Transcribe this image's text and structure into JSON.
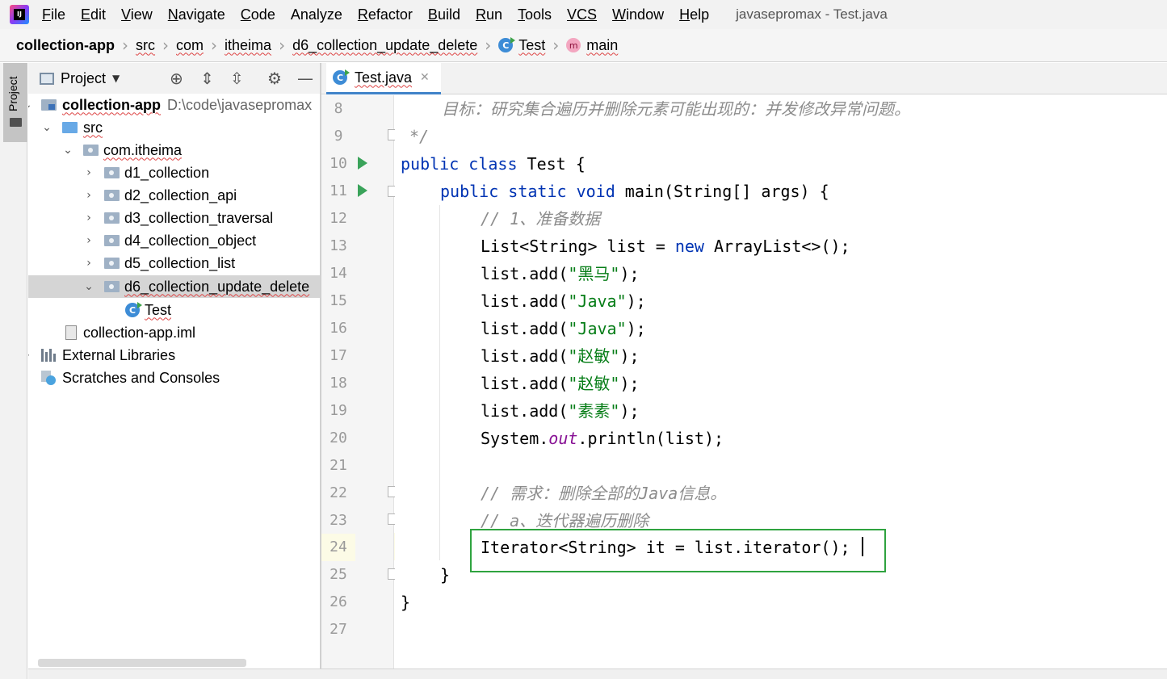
{
  "window": {
    "title": "javasepromax - Test.java"
  },
  "menu": [
    {
      "mn": "F",
      "rest": "ile"
    },
    {
      "mn": "E",
      "rest": "dit"
    },
    {
      "mn": "V",
      "rest": "iew"
    },
    {
      "mn": "N",
      "rest": "avigate"
    },
    {
      "mn": "C",
      "rest": "ode"
    },
    {
      "mn": "",
      "rest": "Analyze"
    },
    {
      "mn": "R",
      "rest": "efactor"
    },
    {
      "mn": "B",
      "rest": "uild"
    },
    {
      "mn": "R",
      "rest": "un"
    },
    {
      "mn": "T",
      "rest": "ools"
    },
    {
      "mn": "VCS",
      "rest": ""
    },
    {
      "mn": "W",
      "rest": "indow"
    },
    {
      "mn": "H",
      "rest": "elp"
    }
  ],
  "breadcrumb": [
    "collection-app",
    "src",
    "com",
    "itheima",
    "d6_collection_update_delete",
    "Test",
    "main"
  ],
  "project_panel": {
    "title": "Project",
    "tool_strip_label": "Project",
    "tree": {
      "module": "collection-app",
      "module_path": "D:\\code\\javasepromax",
      "src": "src",
      "package": "com.itheima",
      "folders": [
        "d1_collection",
        "d2_collection_api",
        "d3_collection_traversal",
        "d4_collection_object",
        "d5_collection_list",
        "d6_collection_update_delete"
      ],
      "class": "Test",
      "iml": "collection-app.iml",
      "ext_libs": "External Libraries",
      "scratches": "Scratches and Consoles"
    }
  },
  "editor": {
    "tab": "Test.java",
    "line_numbers": [
      "8",
      "9",
      "10",
      "11",
      "12",
      "13",
      "14",
      "15",
      "16",
      "17",
      "18",
      "19",
      "20",
      "21",
      "22",
      "23",
      "24",
      "25",
      "26",
      "27"
    ],
    "current_line": "24",
    "lines": {
      "l8": "目标：研究集合遍历并删除元素可能出现的：并发修改异常问题。",
      "l9": "*/",
      "l10_kw": "public class",
      "l10_rest": " Test {",
      "l11_kw1": "public static void",
      "l11_rest": " main(String[] args) {",
      "l12": "// 1、准备数据",
      "l13_a": "List<String> list = ",
      "l13_kw": "new",
      "l13_b": " ArrayList<>();",
      "add_prefix": "list.add(",
      "add_suffix": ");",
      "s14": "\"黑马\"",
      "s15": "\"Java\"",
      "s16": "\"Java\"",
      "s17": "\"赵敏\"",
      "s18": "\"赵敏\"",
      "s19": "\"素素\"",
      "l20_a": "System.",
      "l20_f": "out",
      "l20_b": ".println(list);",
      "l22": "// 需求：删除全部的Java信息。",
      "l23": "// a、迭代器遍历删除",
      "l24": "Iterator<String> it = list.iterator();",
      "l25": "}",
      "l26": "}"
    }
  }
}
